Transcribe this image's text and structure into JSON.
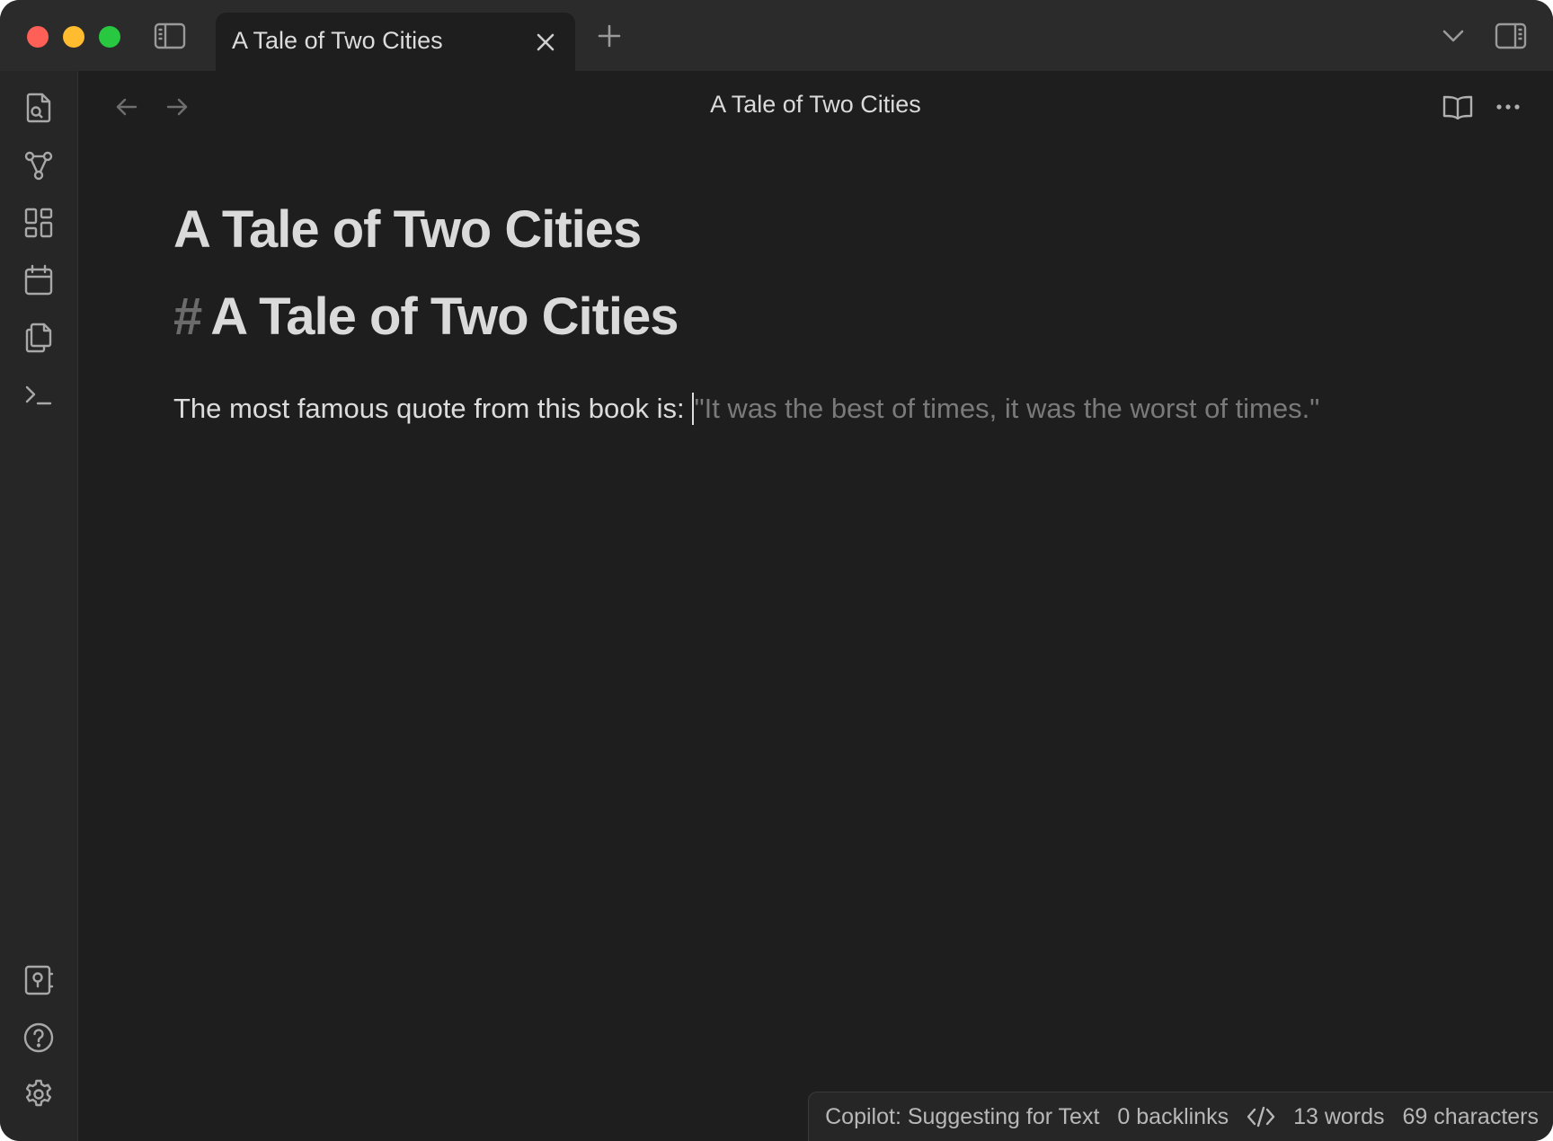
{
  "window": {
    "traffic_lights": [
      "close",
      "minimize",
      "zoom"
    ]
  },
  "titlebar": {
    "tab": {
      "title": "A Tale of Two Cities"
    },
    "icons": [
      "sidebar-toggle-icon",
      "close-icon",
      "plus-icon",
      "chevron-down-icon",
      "right-sidebar-icon"
    ]
  },
  "ribbon": {
    "top_icons": [
      "search-file-icon",
      "graph-icon",
      "canvas-icon",
      "calendar-icon",
      "copy-icon",
      "terminal-icon"
    ],
    "bottom_icons": [
      "vault-icon",
      "help-icon",
      "gear-icon"
    ]
  },
  "editor": {
    "view_title": "A Tale of Two Cities",
    "inline_title": "A Tale of Two Cities",
    "heading_hash": "#",
    "heading_text": "A Tale of Two Cities",
    "paragraph_text": "The most famous quote from this book is:",
    "suggestion_text": "\"It was the best of times, it was the worst of times.\""
  },
  "statusbar": {
    "copilot": "Copilot: Suggesting for Text",
    "backlinks": "0 backlinks",
    "words": "13 words",
    "characters": "69 characters"
  },
  "colors": {
    "background": "#1e1e1e",
    "titlebar": "#2b2b2b",
    "text": "#dadada",
    "muted": "#7a7a7a",
    "red": "#fe5f57",
    "yellow": "#febc2e",
    "green": "#28c840"
  }
}
